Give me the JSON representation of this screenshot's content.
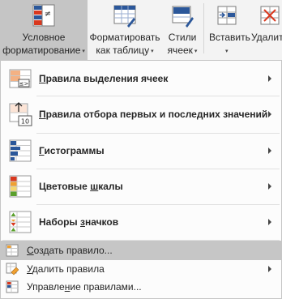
{
  "ribbon": {
    "conditional_formatting": {
      "line1": "Условное",
      "line2": "форматирование",
      "caret": "▾",
      "icon": "conditional-formatting-icon"
    },
    "format_as_table": {
      "line1": "Форматировать",
      "line2": "как таблицу",
      "caret": "▾",
      "icon": "format-as-table-icon"
    },
    "cell_styles": {
      "line1": "Стили",
      "line2": "ячеек",
      "caret": "▾",
      "icon": "cell-styles-icon"
    },
    "insert": {
      "line1": "Вставить",
      "caret": "▾",
      "icon": "insert-cells-icon"
    },
    "delete": {
      "line1": "Удалит",
      "icon": "delete-cells-icon"
    }
  },
  "menu": {
    "items": [
      {
        "pre": "",
        "u": "П",
        "post": "равила выделения ячеек",
        "icon": "highlight-cells-rules-icon",
        "submenu": true
      },
      {
        "pre": "",
        "u": "П",
        "post": "равила отбора первых и последних значений",
        "icon": "top-bottom-rules-icon",
        "submenu": true
      },
      {
        "pre": "",
        "u": "Г",
        "post": "истограммы",
        "icon": "data-bars-icon",
        "submenu": true
      },
      {
        "pre": "Цветовые ",
        "u": "ш",
        "post": "калы",
        "icon": "color-scales-icon",
        "submenu": true
      },
      {
        "pre": "Наборы ",
        "u": "з",
        "post": "начков",
        "icon": "icon-sets-icon",
        "submenu": true
      }
    ],
    "commands": [
      {
        "pre": "",
        "u": "С",
        "post": "оздать правило...",
        "icon": "new-rule-icon",
        "submenu": false,
        "highlighted": true
      },
      {
        "pre": "",
        "u": "У",
        "post": "далить правила",
        "icon": "clear-rules-icon",
        "submenu": true
      },
      {
        "pre": "Управле",
        "u": "н",
        "post": "ие правилами...",
        "icon": "manage-rules-icon",
        "submenu": false
      }
    ]
  },
  "colors": {
    "accent_blue": "#2b579a",
    "orange": "#f0a030",
    "red": "#d9381e",
    "green": "#5aa02c",
    "highlight": "#c6c6c6"
  }
}
